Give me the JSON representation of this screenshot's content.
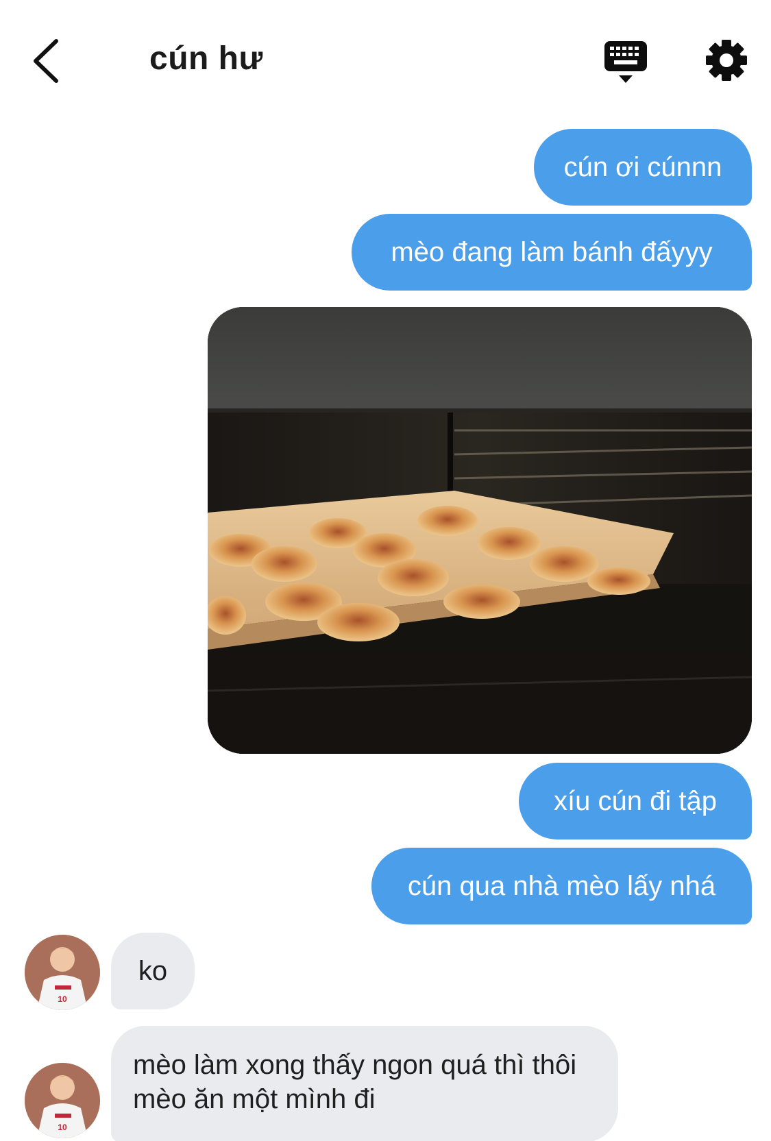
{
  "header": {
    "title": "cún hư",
    "icons": {
      "back": "chevron-left-icon",
      "keyboard": "keyboard-icon",
      "settings": "gear-icon"
    }
  },
  "messages": [
    {
      "sender": "me",
      "type": "text",
      "text": "cún ơi cúnnn"
    },
    {
      "sender": "me",
      "type": "text",
      "text": "mèo đang làm bánh đấyyy"
    },
    {
      "sender": "me",
      "type": "image"
    },
    {
      "sender": "me",
      "type": "text",
      "text": "xíu cún đi tập"
    },
    {
      "sender": "me",
      "type": "text",
      "text": "cún qua nhà mèo lấy nhá"
    },
    {
      "sender": "other",
      "type": "text",
      "text": "ko"
    },
    {
      "sender": "other",
      "type": "text",
      "text": "mèo làm xong thấy ngon quá thì thôi mèo ăn một mình đi"
    }
  ],
  "colors": {
    "sent_bubble": "#4a9eea",
    "received_bubble": "#e9ebef",
    "text_dark": "#1b1b1b"
  }
}
